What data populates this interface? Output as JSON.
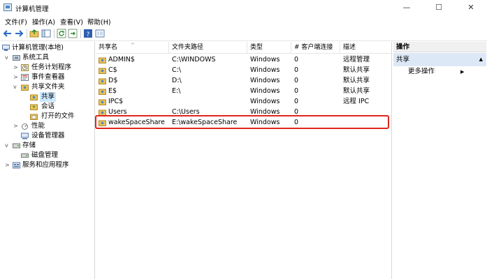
{
  "window": {
    "title": "计算机管理",
    "minimize": "—",
    "maximize": "☐",
    "close": "✕"
  },
  "menu": [
    "文件(F)",
    "操作(A)",
    "查看(V)",
    "帮助(H)"
  ],
  "tree": [
    {
      "label": "计算机管理(本地)",
      "icon": "computer-icon",
      "expand": "",
      "level": 0
    },
    {
      "label": "系统工具",
      "icon": "tools-icon",
      "expand": "v",
      "level": 1
    },
    {
      "label": "任务计划程序",
      "icon": "clock-icon",
      "expand": ">",
      "level": 2
    },
    {
      "label": "事件查看器",
      "icon": "event-icon",
      "expand": ">",
      "level": 2
    },
    {
      "label": "共享文件夹",
      "icon": "share-folder-icon",
      "expand": "v",
      "level": 2
    },
    {
      "label": "共享",
      "icon": "share-icon",
      "expand": "",
      "level": 3,
      "selected": true
    },
    {
      "label": "会话",
      "icon": "session-icon",
      "expand": "",
      "level": 3
    },
    {
      "label": "打开的文件",
      "icon": "open-file-icon",
      "expand": "",
      "level": 3
    },
    {
      "label": "性能",
      "icon": "performance-icon",
      "expand": ">",
      "level": 2
    },
    {
      "label": "设备管理器",
      "icon": "device-icon",
      "expand": "",
      "level": 2
    },
    {
      "label": "存储",
      "icon": "storage-icon",
      "expand": "v",
      "level": 1
    },
    {
      "label": "磁盘管理",
      "icon": "disk-icon",
      "expand": "",
      "level": 2
    },
    {
      "label": "服务和应用程序",
      "icon": "services-icon",
      "expand": ">",
      "level": 1
    }
  ],
  "list": {
    "columns": [
      "共享名",
      "文件夹路径",
      "类型",
      "# 客户端连接",
      "描述"
    ],
    "sort_arrow": "^",
    "rows": [
      [
        "ADMIN$",
        "C:\\WINDOWS",
        "Windows",
        "0",
        "远程管理"
      ],
      [
        "C$",
        "C:\\",
        "Windows",
        "0",
        "默认共享"
      ],
      [
        "D$",
        "D:\\",
        "Windows",
        "0",
        "默认共享"
      ],
      [
        "E$",
        "E:\\",
        "Windows",
        "0",
        "默认共享"
      ],
      [
        "IPC$",
        "",
        "Windows",
        "0",
        "远程 IPC"
      ],
      [
        "Users",
        "C:\\Users",
        "Windows",
        "0",
        ""
      ],
      [
        "wakeSpaceShare",
        "E:\\wakeSpaceShare",
        "Windows",
        "0",
        ""
      ]
    ],
    "highlight_color": "#e0241e"
  },
  "actions": {
    "header": "操作",
    "section": "共享",
    "section_arrow": "▲",
    "item": "更多操作",
    "item_arrow": "▶"
  }
}
